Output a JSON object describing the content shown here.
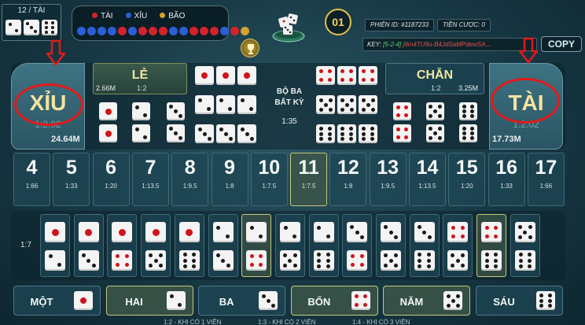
{
  "last_roll": {
    "label": "12 / TÀI",
    "dice": [
      2,
      3,
      6
    ]
  },
  "history": {
    "legend": [
      {
        "label": "TÀI",
        "color": "#d3232b"
      },
      {
        "label": "XỈU",
        "color": "#2b5fd6"
      },
      {
        "label": "BÃO",
        "color": "#d4a22e"
      }
    ],
    "beads": [
      "#2b5fd6",
      "#2b5fd6",
      "#2b5fd6",
      "#2b5fd6",
      "#d3232b",
      "#2b5fd6",
      "#d3232b",
      "#d3232b",
      "#d3232b",
      "#2b5fd6",
      "#2b5fd6",
      "#d3232b",
      "#d3232b",
      "#d3232b",
      "#2b5fd6",
      "#d3232b",
      "#d4a22e"
    ]
  },
  "round": {
    "number": "01"
  },
  "info": {
    "session": "PHIÊN ID:  #1187233",
    "bet": "TIỀN CƯỢC: 0"
  },
  "key": {
    "label": "KEY: ",
    "dice": "[5-2-4]",
    "hash": "j9m4TU9o-B4JdSaMPdewSA..."
  },
  "copy_label": "COPY",
  "xiu": {
    "title": "XỈU",
    "ratio": "1:2.02",
    "amount": "24.64M"
  },
  "tai": {
    "title": "TÀI",
    "ratio": "1:2.02",
    "amount": "17.73M"
  },
  "le": {
    "title": "LẺ",
    "amount": "2.66M",
    "ratio": "1:2"
  },
  "chan": {
    "title": "CHẴN",
    "amount": "3.25M",
    "ratio": "1:2"
  },
  "any_triple": {
    "line1": "BỘ BA",
    "line2": "BẤT KỲ",
    "ratio": "1:35"
  },
  "totals": [
    {
      "n": "4",
      "o": "1:66"
    },
    {
      "n": "5",
      "o": "1:33"
    },
    {
      "n": "6",
      "o": "1:20"
    },
    {
      "n": "7",
      "o": "1:13.5"
    },
    {
      "n": "8",
      "o": "1:9.5"
    },
    {
      "n": "9",
      "o": "1:8"
    },
    {
      "n": "10",
      "o": "1:7.5"
    },
    {
      "n": "11",
      "o": "1:7.5"
    },
    {
      "n": "12",
      "o": "1:8"
    },
    {
      "n": "13",
      "o": "1:9.5"
    },
    {
      "n": "14",
      "o": "1:13.5"
    },
    {
      "n": "15",
      "o": "1:20"
    },
    {
      "n": "16",
      "o": "1:33"
    },
    {
      "n": "17",
      "o": "1:66"
    }
  ],
  "combo_ratio": "1:7",
  "singles": [
    {
      "label": "MỘT",
      "face": 1
    },
    {
      "label": "HAI",
      "face": 2
    },
    {
      "label": "BA",
      "face": 3
    },
    {
      "label": "BỐN",
      "face": 4
    },
    {
      "label": "NĂM",
      "face": 5
    },
    {
      "label": "SÁU",
      "face": 6
    }
  ],
  "bottom_notes": [
    "1:2 - KHI CÓ 1 VIÊN",
    "1:3 - KHI CÓ 2 VIÊN",
    "1:4 - KHI CÓ 3 VIÊN"
  ]
}
